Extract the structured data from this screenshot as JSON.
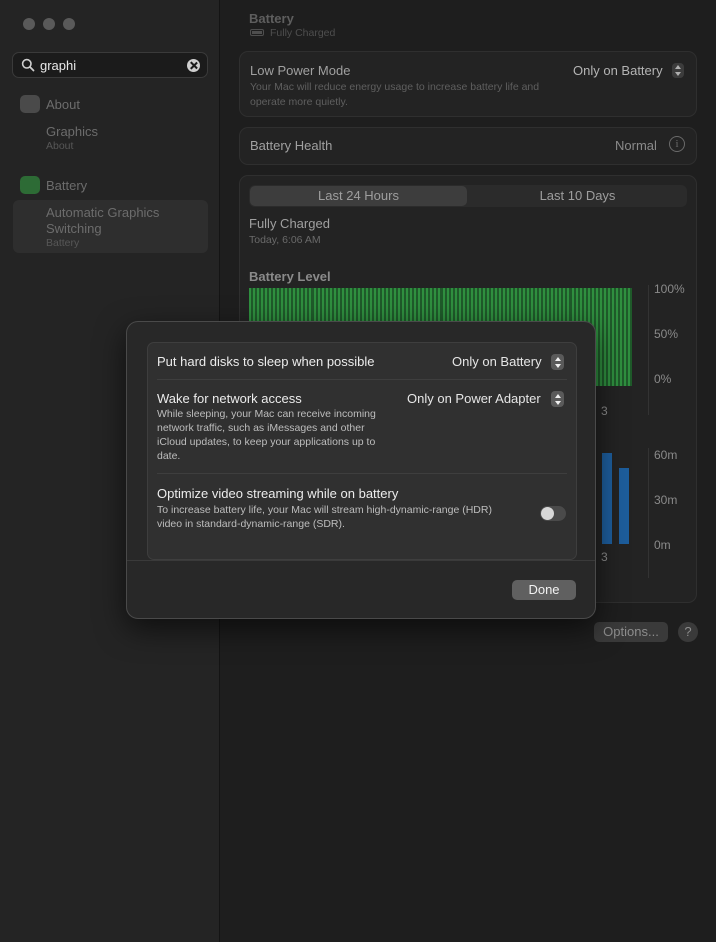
{
  "window": {
    "title": "Battery",
    "status": "Fully Charged"
  },
  "sidebar": {
    "search_value": "graphi",
    "items": [
      {
        "label": "About",
        "icon": "about-icon"
      },
      {
        "label": "Graphics",
        "sublabel": "About"
      },
      {
        "label": "Battery",
        "icon": "battery-icon"
      },
      {
        "label": "Automatic Graphics Switching",
        "sublabel": "Battery"
      }
    ]
  },
  "low_power": {
    "title": "Low Power Mode",
    "description": "Your Mac will reduce energy usage to increase battery life and operate more quietly.",
    "value": "Only on Battery"
  },
  "health": {
    "title": "Battery Health",
    "value": "Normal"
  },
  "history": {
    "tabs": [
      "Last 24 Hours",
      "Last 10 Days"
    ],
    "selected_tab": "Last 24 Hours",
    "status_title": "Fully Charged",
    "status_time": "Today, 6:06 AM",
    "level_title": "Battery Level",
    "level_axis": [
      "100%",
      "50%",
      "0%"
    ],
    "level_x_label": "3",
    "usage_axis": [
      "60m",
      "30m",
      "0m"
    ],
    "usage_x_label": "3"
  },
  "chart_data": {
    "type": "bar",
    "title": "Battery Level",
    "ylabel": "",
    "ylim": [
      0,
      100
    ],
    "values_percent_note": "",
    "values": [
      100,
      100,
      100,
      100,
      100,
      100,
      100,
      100,
      100,
      100,
      100,
      100,
      100,
      100,
      100,
      100,
      100,
      100,
      100,
      100,
      100,
      100,
      100,
      100
    ]
  },
  "footer": {
    "options_label": "Options...",
    "help_label": "?"
  },
  "dialog": {
    "rows": [
      {
        "title": "Put hard disks to sleep when possible",
        "value": "Only on Battery"
      },
      {
        "title": "Wake for network access",
        "description": "While sleeping, your Mac can receive incoming network traffic, such as iMessages and other iCloud updates, to keep your applications up to date.",
        "value": "Only on Power Adapter"
      },
      {
        "title": "Optimize video streaming while on battery",
        "description": "To increase battery life, your Mac will stream high-dynamic-range (HDR) video in standard-dynamic-range (SDR).",
        "enabled": false
      }
    ],
    "done_label": "Done"
  }
}
